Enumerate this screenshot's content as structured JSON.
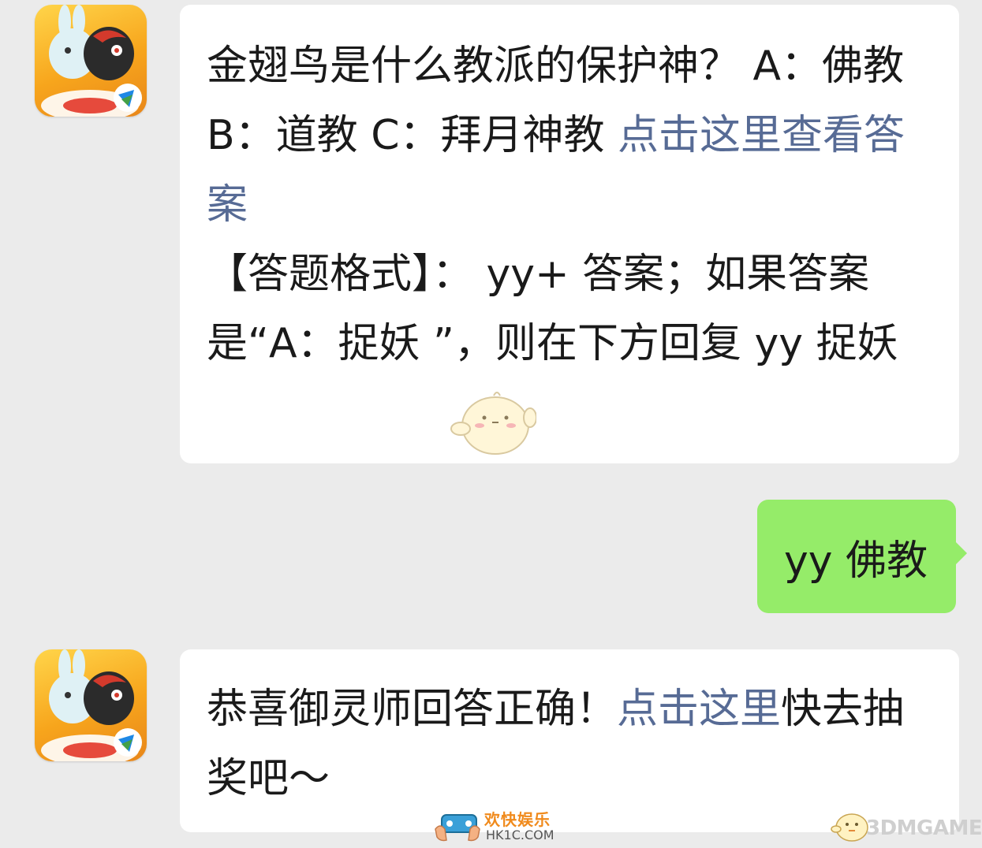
{
  "conversation": {
    "message_1": {
      "question": "金翅鸟是什么教派的保护神？ A：佛教 B：道教 C：拜月神教 ",
      "link": "点击这里查看答案",
      "format_line": "【答题格式】： yy+ 答案；如果答案是“A：捉妖 ”，则在下方回复 yy 捉妖"
    },
    "message_2": {
      "text": "yy 佛教"
    },
    "message_3": {
      "prefix": "恭喜御灵师回答正确！",
      "link": "点击这里",
      "suffix": "快去抽奖吧～"
    }
  },
  "watermarks": {
    "hk1c_title": "欢快娱乐",
    "hk1c_domain": "HK1C.COM",
    "three_dm": "3DMGAME"
  },
  "colors": {
    "background": "#ebebeb",
    "incoming_bubble": "#ffffff",
    "outgoing_bubble": "#95ec69",
    "link": "#576b95",
    "avatar_gradient": "#f7a51c"
  },
  "icons": {
    "avatar": "game-character-avatar-icon",
    "sticker": "chick-sticker-icon"
  }
}
